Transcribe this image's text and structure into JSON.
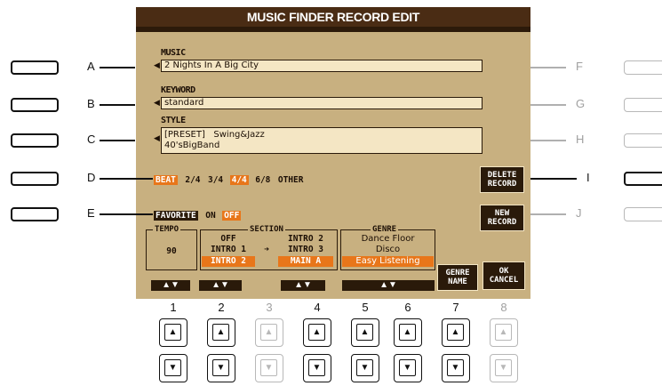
{
  "title": "MUSIC FINDER RECORD EDIT",
  "music": {
    "label": "MUSIC",
    "value": "2 Nights In A Big City"
  },
  "keyword": {
    "label": "KEYWORD",
    "value": "standard"
  },
  "style": {
    "label": "STYLE",
    "line1": "[PRESET]   Swing&Jazz",
    "line2": "40'sBigBand"
  },
  "beat": {
    "label": "BEAT",
    "options": [
      "2/4",
      "3/4",
      "4/4",
      "6/8",
      "OTHER"
    ],
    "selected": "4/4"
  },
  "favorite": {
    "label": "FAVORITE",
    "on": "ON",
    "off": "OFF",
    "selected": "OFF"
  },
  "tempo": {
    "title": "TEMPO",
    "value": "90"
  },
  "section": {
    "title": "SECTION",
    "left": [
      "OFF",
      "INTRO 1",
      "INTRO 2"
    ],
    "arrow": "➜",
    "right": [
      "INTRO 2",
      "INTRO 3",
      "MAIN A"
    ],
    "selected_left": "INTRO 2",
    "selected_right": "MAIN A"
  },
  "genre": {
    "title": "GENRE",
    "items": [
      "Dance Floor",
      "Disco",
      "Easy Listening"
    ],
    "selected": "Easy Listening"
  },
  "buttons": {
    "delete_record": [
      "DELETE",
      "RECORD"
    ],
    "new_record": [
      "NEW",
      "RECORD"
    ],
    "genre_name": [
      "GENRE",
      "NAME"
    ],
    "ok_cancel": [
      "OK",
      "CANCEL"
    ]
  },
  "step_glyph": "▲▼",
  "side_left": [
    "A",
    "B",
    "C",
    "D",
    "E"
  ],
  "side_right": [
    "F",
    "G",
    "H",
    "I",
    "J"
  ],
  "active_right": "I",
  "numbers": [
    "1",
    "2",
    "3",
    "4",
    "5",
    "6",
    "7",
    "8"
  ],
  "inactive_numbers": [
    "3",
    "8"
  ],
  "up_glyph": "▲",
  "down_glyph": "▼",
  "colors": {
    "lcd": "#c8b080",
    "title": "#4a2c14",
    "accent": "#e8761a",
    "dark": "#2a1a0a"
  }
}
